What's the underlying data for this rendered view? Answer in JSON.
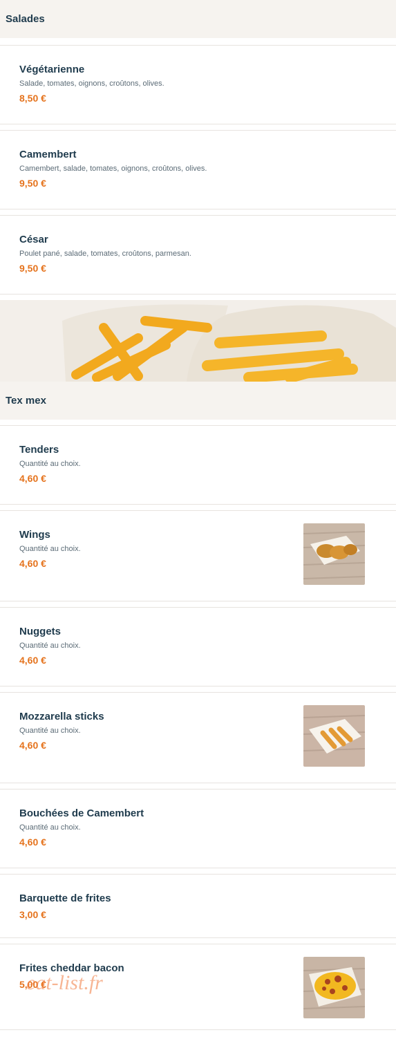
{
  "sections": [
    {
      "title": "Salades",
      "items": [
        {
          "name": "Végétarienne",
          "desc": "Salade, tomates, oignons, croûtons, olives.",
          "price": "8,50 €"
        },
        {
          "name": "Camembert",
          "desc": "Camembert, salade, tomates, oignons, croûtons, olives.",
          "price": "9,50 €"
        },
        {
          "name": "César",
          "desc": "Poulet pané, salade, tomates, croûtons, parmesan.",
          "price": "9,50 €"
        }
      ]
    },
    {
      "title": "Tex mex",
      "items": [
        {
          "name": "Tenders",
          "desc": "Quantité au choix.",
          "price": "4,60 €"
        },
        {
          "name": "Wings",
          "desc": "Quantité au choix.",
          "price": "4,60 €"
        },
        {
          "name": "Nuggets",
          "desc": "Quantité au choix.",
          "price": "4,60 €"
        },
        {
          "name": "Mozzarella sticks",
          "desc": "Quantité au choix.",
          "price": "4,60 €"
        },
        {
          "name": "Bouchées de Camembert",
          "desc": "Quantité au choix.",
          "price": "4,60 €"
        },
        {
          "name": "Barquette de frites",
          "price": "3,00 €"
        },
        {
          "name": "Frites cheddar bacon",
          "price": "5,00 €"
        }
      ]
    }
  ],
  "watermark": "eat-list.fr",
  "colors": {
    "price": "#e5731d",
    "title": "#1f3b4d",
    "header_bg": "#f6f3ef"
  }
}
